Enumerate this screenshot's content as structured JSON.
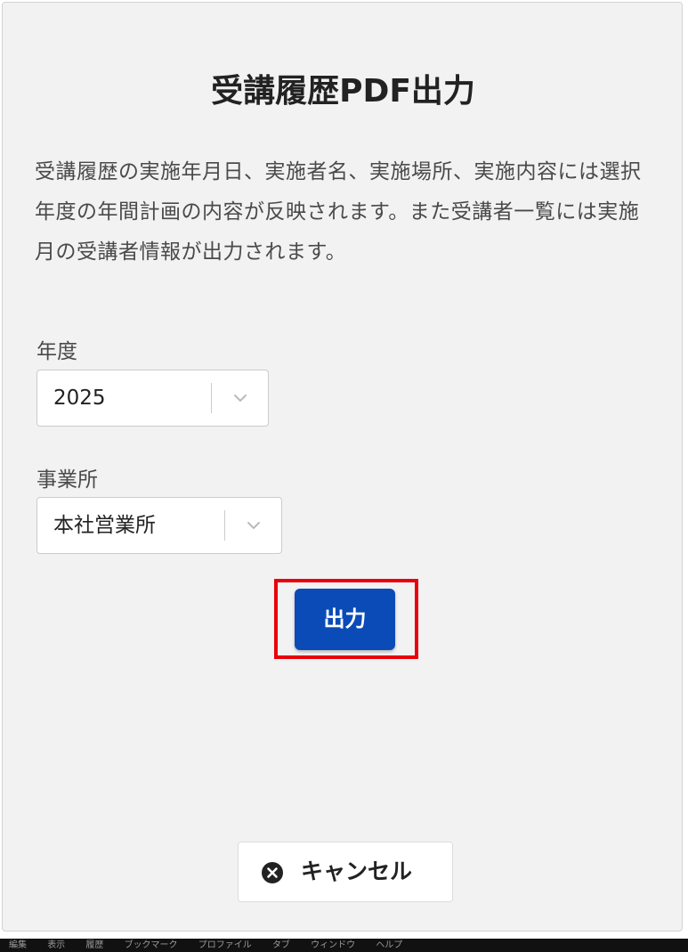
{
  "dialog": {
    "title": "受講履歴PDF出力",
    "description": "受講履歴の実施年月日、実施者名、実施場所、実施内容には選択年度の年間計画の内容が反映されます。また受講者一覧には実施月の受講者情報が出力されます。"
  },
  "year_field": {
    "label": "年度",
    "value": "2025"
  },
  "office_field": {
    "label": "事業所",
    "value": "本社営業所"
  },
  "buttons": {
    "output_label": "出力",
    "cancel_label": "キャンセル"
  },
  "colors": {
    "primary": "#0b4bb7",
    "highlight": "#e8000b"
  },
  "icons": {
    "select_indicator": "chevron-down-icon",
    "cancel": "close-circle-icon"
  },
  "menubar": {
    "items": [
      "編集",
      "表示",
      "履歴",
      "ブックマーク",
      "プロファイル",
      "タブ",
      "ウィンドウ",
      "ヘルプ"
    ]
  }
}
